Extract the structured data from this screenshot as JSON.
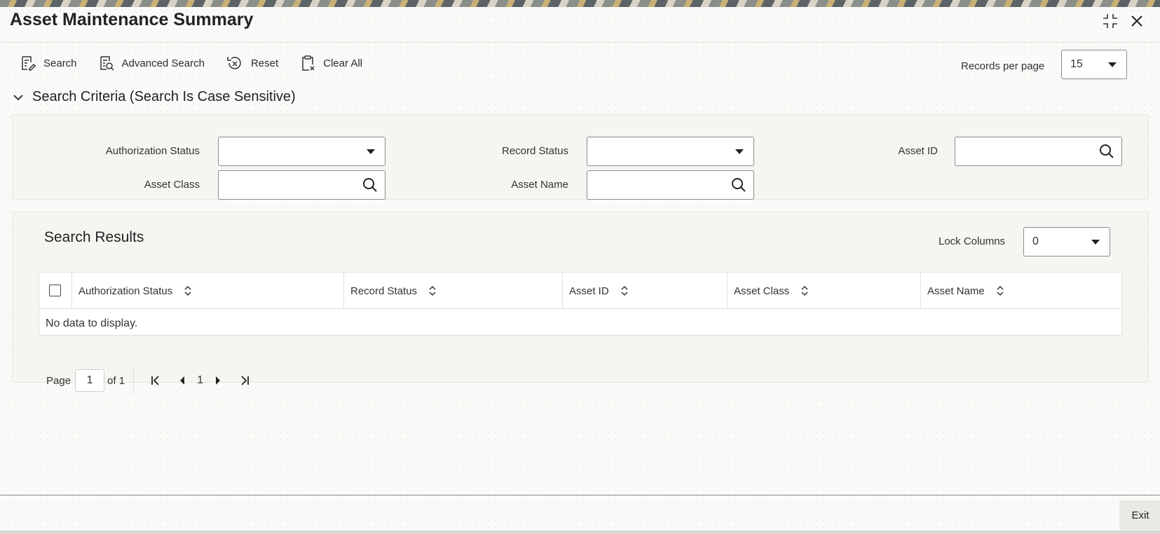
{
  "window": {
    "title": "Asset Maintenance Summary"
  },
  "toolbar": {
    "search_label": "Search",
    "advanced_search_label": "Advanced Search",
    "reset_label": "Reset",
    "clear_all_label": "Clear All"
  },
  "records_per_page": {
    "label": "Records per page",
    "value": "15"
  },
  "search_criteria": {
    "heading": "Search Criteria (Search Is Case Sensitive)",
    "fields": {
      "authorization_status": {
        "label": "Authorization Status",
        "value": ""
      },
      "record_status": {
        "label": "Record Status",
        "value": ""
      },
      "asset_id": {
        "label": "Asset ID",
        "value": ""
      },
      "asset_class": {
        "label": "Asset Class",
        "value": ""
      },
      "asset_name": {
        "label": "Asset Name",
        "value": ""
      }
    }
  },
  "search_results": {
    "title": "Search Results",
    "lock_columns_label": "Lock Columns",
    "lock_columns_value": "0",
    "columns": [
      "Authorization Status",
      "Record Status",
      "Asset ID",
      "Asset Class",
      "Asset Name"
    ],
    "empty_message": "No data to display."
  },
  "pagination": {
    "page_label": "Page",
    "current_page": "1",
    "of_label": "of 1",
    "page_number": "1"
  },
  "footer": {
    "exit_label": "Exit"
  },
  "colors": {
    "background": "#fbfaf8",
    "panel": "#f6f5f2",
    "border": "#8a8a8a"
  }
}
